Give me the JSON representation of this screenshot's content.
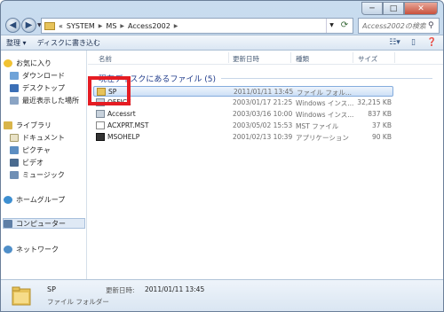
{
  "window": {
    "minimize_label": "─",
    "maximize_label": "□",
    "close_label": "✕"
  },
  "address": {
    "prefix": "«",
    "crumbs": [
      "SYSTEM",
      "MS",
      "Access2002"
    ]
  },
  "search": {
    "placeholder": "Access2002の検索"
  },
  "toolbar": {
    "organize_label": "整理 ▾",
    "burn_label": "ディスクに書き込む"
  },
  "navpane": {
    "favorites": "お気に入り",
    "downloads": "ダウンロード",
    "desktop": "デスクトップ",
    "recent": "最近表示した場所",
    "libraries": "ライブラリ",
    "documents": "ドキュメント",
    "pictures": "ピクチャ",
    "videos": "ビデオ",
    "music": "ミュージック",
    "homegroup": "ホームグループ",
    "computer": "コンピューター",
    "network": "ネットワーク"
  },
  "columns": {
    "name": "名前",
    "date": "更新日時",
    "type": "種類",
    "size": "サイズ"
  },
  "group": {
    "title": "現在ディスクにあるファイル (5)"
  },
  "files": [
    {
      "name": "SP",
      "date": "2011/01/11 13:45",
      "type": "ファイル フォル...",
      "size": "",
      "icon": "folder-icon"
    },
    {
      "name": "OFFICE",
      "date": "2003/01/17 21:25",
      "type": "Windows インス...",
      "size": "32,215 KB",
      "icon": "installer-icon"
    },
    {
      "name": "Accessrt",
      "date": "2003/03/16 10:00",
      "type": "Windows インス...",
      "size": "837 KB",
      "icon": "installer-icon"
    },
    {
      "name": "ACXPRT.MST",
      "date": "2003/05/02 15:53",
      "type": "MST ファイル",
      "size": "37 KB",
      "icon": "file-icon"
    },
    {
      "name": "MSOHELP",
      "date": "2001/02/13 10:39",
      "type": "アプリケーション",
      "size": "90 KB",
      "icon": "app-icon"
    }
  ],
  "details": {
    "name": "SP",
    "type": "ファイル フォルダー",
    "modified_label": "更新日時:",
    "modified_value": "2011/01/11 13:45"
  },
  "colors": {
    "highlight_box": "#e51c23",
    "folder": "#e7c35a",
    "group_title": "#1e3a8a"
  }
}
